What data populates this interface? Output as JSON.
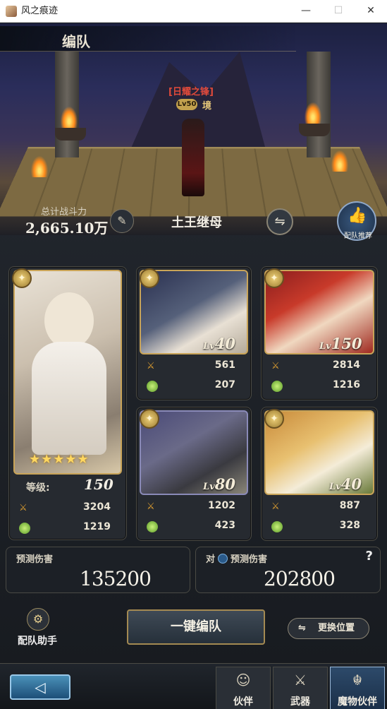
{
  "window": {
    "title": "风之痕迹",
    "minimize": "—",
    "maximize": "☐",
    "close": "✕"
  },
  "screen_title": "编队",
  "boss": {
    "name": "[日耀之锋]",
    "level": "Lv50",
    "state": "境"
  },
  "team": {
    "power_label": "总计战斗力",
    "power_value": "2,665.10万",
    "name": "土王继母",
    "recommend_label": "配队推荐",
    "edit_icon": "✎",
    "swap_icon": "⇋"
  },
  "leader": {
    "level_label": "等级:",
    "level": "150",
    "stars": "★★★★★",
    "attack": "3204",
    "hp": "1219",
    "element_icon": "sun-icon"
  },
  "members": [
    {
      "lv_prefix": "Lv",
      "level": "40",
      "attack": "561",
      "hp": "207"
    },
    {
      "lv_prefix": "Lv",
      "level": "150",
      "attack": "2814",
      "hp": "1216"
    },
    {
      "lv_prefix": "Lv",
      "level": "80",
      "attack": "1202",
      "hp": "423"
    },
    {
      "lv_prefix": "Lv",
      "level": "40",
      "attack": "887",
      "hp": "328"
    }
  ],
  "damage": {
    "predicted_label": "预测伤害",
    "predicted_value": "135200",
    "vs_prefix": "对",
    "vs_label": "预测伤害",
    "vs_value": "202800",
    "help": "?"
  },
  "actions": {
    "assist_label": "配队助手",
    "auto_team": "一键编队",
    "swap_position": "更换位置"
  },
  "nav": {
    "back_icon": "◁",
    "tabs": [
      {
        "label": "伙伴",
        "icon": "companion-icon"
      },
      {
        "label": "武器",
        "icon": "weapon-icon"
      },
      {
        "label": "魔物伙伴",
        "icon": "monster-icon",
        "active": true
      }
    ]
  },
  "colors": {
    "gold_border": "#c9a458",
    "accent_blue": "#2d4a6a",
    "boss_red": "#e04a3a"
  }
}
